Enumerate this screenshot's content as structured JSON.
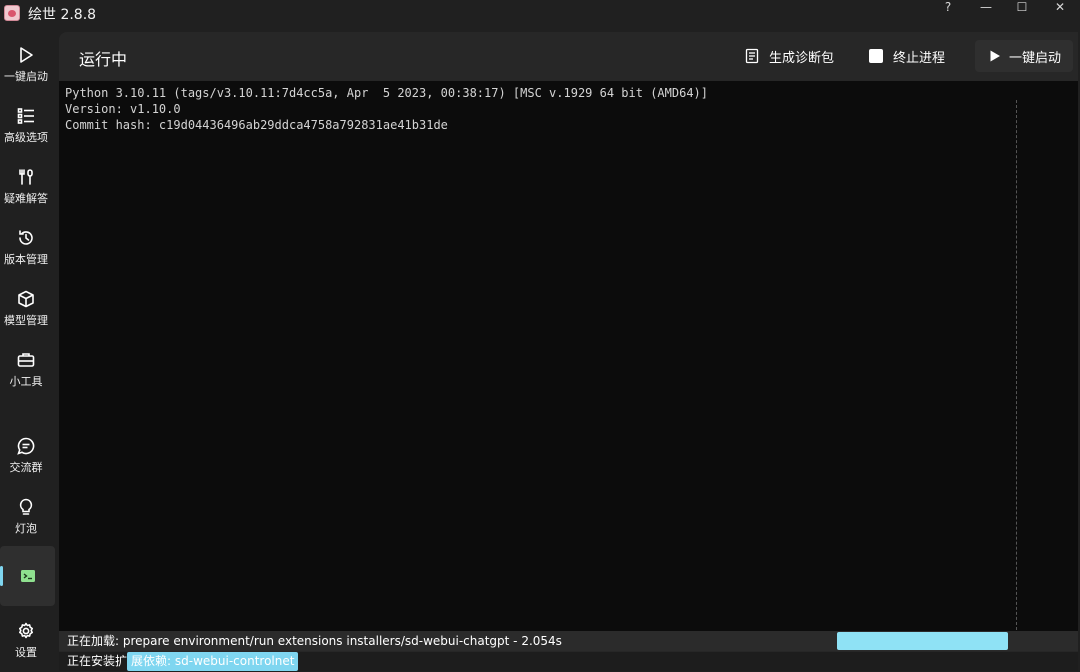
{
  "window": {
    "title": "绘世 2.8.8",
    "controls": {
      "help": "?",
      "minimize": "—",
      "maximize": "☐",
      "close": "✕"
    }
  },
  "sidebar": {
    "items": [
      {
        "label": "一键启动",
        "icon": "play-icon"
      },
      {
        "label": "高级选项",
        "icon": "list-icon"
      },
      {
        "label": "疑难解答",
        "icon": "tools-icon"
      },
      {
        "label": "版本管理",
        "icon": "history-icon"
      },
      {
        "label": "模型管理",
        "icon": "cube-icon"
      },
      {
        "label": "小工具",
        "icon": "toolbox-icon"
      },
      {
        "label": "交流群",
        "icon": "chat-icon"
      },
      {
        "label": "灯泡",
        "icon": "bulb-icon"
      },
      {
        "label": "",
        "icon": "console-icon",
        "active": true
      },
      {
        "label": "设置",
        "icon": "gear-icon"
      }
    ],
    "accent": "#7fd6f0"
  },
  "main": {
    "title": "运行中",
    "toolbar": {
      "diagnostic_label": "生成诊断包",
      "stop_label": "终止进程",
      "start_label": "一键启动"
    },
    "console_lines": [
      "Python 3.10.11 (tags/v3.10.11:7d4cc5a, Apr  5 2023, 00:38:17) [MSC v.1929 64 bit (AMD64)]",
      "Version: v1.10.0",
      "Commit hash: c19d04436496ab29ddca4758a792831ae41b31de"
    ]
  },
  "status": {
    "loading_text": "正在加载: prepare environment/run extensions installers/sd-webui-chatgpt - 2.054s",
    "installing_prefix": "正在安装扩",
    "installing_highlight": "展依赖: sd-webui-controlnet",
    "progress_color": "#8fe2f5"
  }
}
